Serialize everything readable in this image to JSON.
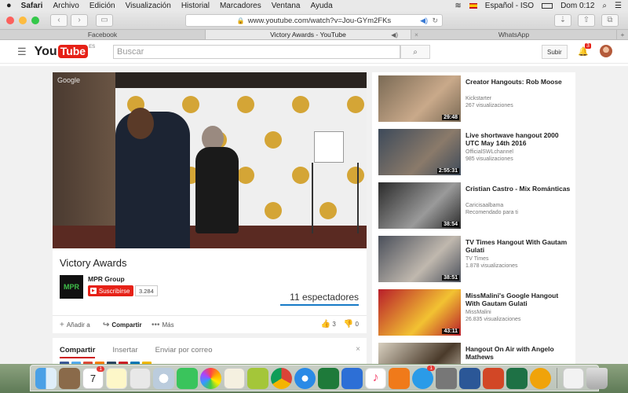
{
  "menubar": {
    "apple": "",
    "items": [
      "Safari",
      "Archivo",
      "Edición",
      "Visualización",
      "Historial",
      "Marcadores",
      "Ventana",
      "Ayuda"
    ],
    "input_source": "Español - ISO",
    "clock": "Dom 0:12"
  },
  "browser": {
    "url": "www.youtube.com/watch?v=Jou-GYm2FKs",
    "tabs": [
      {
        "label": "Facebook"
      },
      {
        "label": "Victory Awards - YouTube"
      },
      {
        "label": "WhatsApp"
      }
    ]
  },
  "youtube": {
    "logo_you": "You",
    "logo_tube": "Tube",
    "region": "ES",
    "search_placeholder": "Buscar",
    "upload_label": "Subir",
    "notification_count": "3"
  },
  "video": {
    "watermark": "Google",
    "title": "Victory Awards",
    "channel_logo_text": "MPR",
    "channel": "MPR Group",
    "subscribe_label": "Suscribirse",
    "subscriber_count": "3.284",
    "viewers": "11 espectadores",
    "actions": {
      "add_to": "Añadir a",
      "share": "Compartir",
      "more": "Más"
    },
    "likes": "3",
    "dislikes": "0"
  },
  "share_panel": {
    "tabs": [
      "Compartir",
      "Insertar",
      "Enviar por correo"
    ],
    "close": "×"
  },
  "recommendations": [
    {
      "title": "Creator Hangouts: Rob Moose",
      "channel": "Kickstarter",
      "views": "267 visualizaciones",
      "duration": "29:48",
      "colors": [
        "#7a6a55",
        "#c9a98a"
      ]
    },
    {
      "title": "Live shortwave hangout 2000 UTC May 14th 2016",
      "channel": "OfficialSWLchannel",
      "views": "985 visualizaciones",
      "duration": "2:55:31",
      "colors": [
        "#3d4a5a",
        "#8a7a6a"
      ]
    },
    {
      "title": "Cristian Castro - Mix Románticas",
      "channel": "Caricisaalbama",
      "views": "Recomendado para ti",
      "duration": "38:54",
      "colors": [
        "#2a2a2a",
        "#9a9a9a"
      ]
    },
    {
      "title": "TV Times Hangout With Gautam Gulati",
      "channel": "TV Times",
      "views": "1.878 visualizaciones",
      "duration": "38:51",
      "colors": [
        "#4a4f5a",
        "#c0b8ae"
      ]
    },
    {
      "title": "MissMalini's Google Hangout With Gautam Gulati",
      "channel": "MissMalini",
      "views": "26.835 visualizaciones",
      "duration": "43:11",
      "colors": [
        "#b81d2a",
        "#f2c232"
      ]
    },
    {
      "title": "Hangout On Air with Angelo Mathews",
      "channel": "",
      "views": "",
      "duration": "",
      "colors": [
        "#d8d0c0",
        "#4a3a2a"
      ]
    }
  ],
  "dock": {
    "calendar_day": "7",
    "calendar_badge": "1",
    "appstore_badge": "1"
  }
}
